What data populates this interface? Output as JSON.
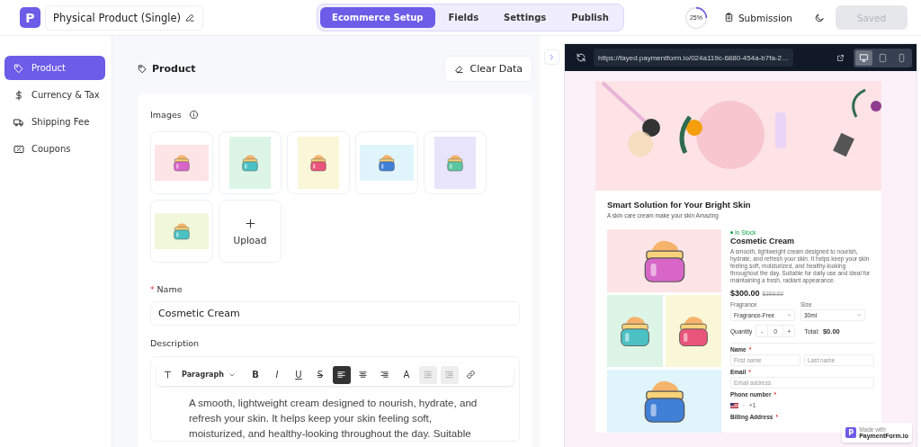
{
  "header": {
    "logo": "P",
    "title": "Physical Product (Single)",
    "tabs": [
      {
        "label": "Ecommerce Setup",
        "selected": true
      },
      {
        "label": "Fields",
        "selected": false
      },
      {
        "label": "Settings",
        "selected": false
      },
      {
        "label": "Publish",
        "selected": false
      }
    ],
    "progress": {
      "level": 0.25,
      "label": "25%"
    },
    "submission": "Submission",
    "save_button": {
      "label": "Saved",
      "disabled": true
    }
  },
  "sidebar": {
    "items": [
      {
        "label": "Product",
        "selected": true
      },
      {
        "label": "Currency & Tax",
        "selected": false
      },
      {
        "label": "Shipping Fee",
        "selected": false
      },
      {
        "label": "Coupons",
        "selected": false
      }
    ]
  },
  "editor": {
    "heading": "Product",
    "clear_button": "Clear Data",
    "images_label": "Images",
    "images": [
      {
        "color": "#fde4e6"
      },
      {
        "color": "#ddf5e6"
      },
      {
        "color": "#f9f7d8"
      },
      {
        "color": "#e0f4fb"
      },
      {
        "color": "#e7e4fb"
      },
      {
        "color": "#f1f7d9"
      }
    ],
    "upload_label": "Upload",
    "name_field": {
      "label": "Name",
      "required_mark": "*",
      "value": "Cosmetic Cream"
    },
    "description_label": "Description",
    "toolbar": {
      "block_style": "Paragraph",
      "buttons": [
        {
          "kind": "bold",
          "label": "B",
          "active": false,
          "disabled": false
        },
        {
          "kind": "italic",
          "label": "I",
          "active": false,
          "disabled": false
        },
        {
          "kind": "underline",
          "label": "U",
          "active": false,
          "disabled": false
        },
        {
          "kind": "strike",
          "label": "S",
          "active": false,
          "disabled": false
        },
        {
          "kind": "align-left",
          "active": true,
          "disabled": false
        },
        {
          "kind": "align-center",
          "active": false,
          "disabled": false
        },
        {
          "kind": "align-right",
          "active": false,
          "disabled": false
        },
        {
          "kind": "color",
          "label": "A",
          "active": false,
          "disabled": false
        },
        {
          "kind": "indent",
          "active": false,
          "disabled": true
        },
        {
          "kind": "outdent",
          "active": false,
          "disabled": true
        },
        {
          "kind": "link",
          "active": false,
          "disabled": false
        }
      ]
    },
    "description_text": "A smooth, lightweight cream designed to nourish, hydrate, and refresh your skin. It helps keep your skin feeling soft, moisturized, and healthy-looking throughout the day. Suitable"
  },
  "preview": {
    "url": "https://fayed.paymentform.io/024a119c-6880-454a-b7fa-2…",
    "devices": [
      {
        "selected": true
      },
      {
        "selected": false
      },
      {
        "selected": false
      }
    ],
    "page": {
      "title": "Smart Solution for Your Bright Skin",
      "subtitle": "A skin care cream make your skin Amazing",
      "gallery": [
        {
          "color": "#fde4e6"
        },
        {
          "color": "#ddf5e6"
        },
        {
          "color": "#f9f7d8"
        },
        {
          "color": "#e0f4fb"
        }
      ],
      "stock": "In Stock",
      "product_name": "Cosmetic Cream",
      "product_description": "A smooth, lightweight cream designed to nourish, hydrate, and refresh your skin. It helps keep your skin feeling soft, moisturized, and healthy-looking throughout the day. Suitable for daily use and ideal for maintaining a fresh, radiant appearance.",
      "price": "$300.00",
      "old_price": "$399.00",
      "options": [
        {
          "label": "Fragrance",
          "value": "Fragrance-Free"
        },
        {
          "label": "Size",
          "value": "30ml"
        }
      ],
      "quantity": {
        "label": "Quantity",
        "minus": "-",
        "value": "0",
        "plus": "+"
      },
      "total": {
        "label": "Total:",
        "value": "$0.00"
      },
      "fields": [
        {
          "label": "Name",
          "required_mark": "*",
          "inputs": [
            "First name",
            "Last name"
          ]
        },
        {
          "label": "Email",
          "required_mark": "*",
          "inputs": [
            "Email address"
          ]
        },
        {
          "label": "Phone number",
          "required_mark": "*",
          "code": "+1"
        },
        {
          "label": "Billing Address",
          "required_mark": "*"
        }
      ]
    },
    "badge": {
      "logo": "P",
      "line1": "Made with",
      "line2": "PaymentForm.io"
    }
  }
}
